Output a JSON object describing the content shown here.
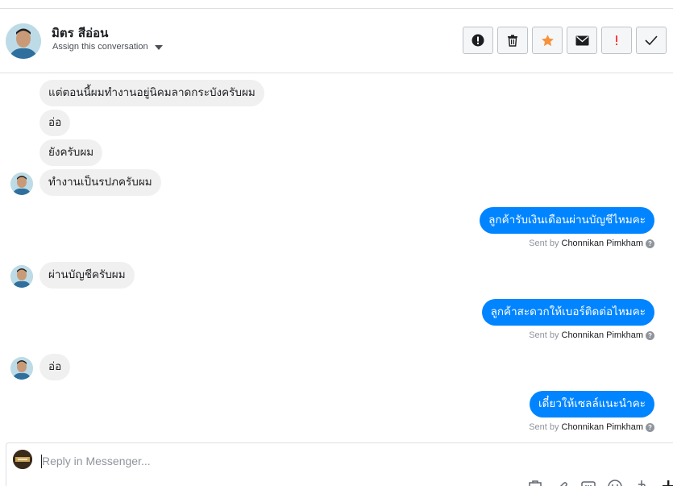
{
  "header": {
    "contact_name": "มิตร สีอ่อน",
    "assign_label": "Assign this conversation",
    "actions": [
      {
        "icon": "exclamation-circle-icon",
        "color": "#1c1e21"
      },
      {
        "icon": "trash-icon",
        "color": "#1c1e21"
      },
      {
        "icon": "star-icon",
        "color": "#f7923b"
      },
      {
        "icon": "envelope-icon",
        "color": "#1c1e21"
      },
      {
        "icon": "exclamation-icon",
        "color": "#fa3e3e"
      },
      {
        "icon": "checkmark-icon",
        "color": "#1c1e21"
      }
    ]
  },
  "messages": {
    "in_1": "แต่ตอนนี้ผมทำงานอยู่นิคมลาดกระบังครับผม",
    "in_2": "อ่อ",
    "in_3": "ยังครับผม",
    "in_4": "ทำงานเป็นรปภครับผม",
    "out_1": "ลูกค้ารับเงินเดือนผ่านบัญชีไหมคะ",
    "in_5": "ผ่านบัญชีครับผม",
    "out_2": "ลูกค้าสะดวกให้เบอร์ติดต่อไหมคะ",
    "in_6": "อ่อ",
    "out_3": "เดี๋ยวให้เซลล์แนะนำคะ"
  },
  "sent_by": {
    "prefix": "Sent by",
    "agent": "Chonnikan Pimkham"
  },
  "composer": {
    "placeholder": "Reply in Messenger..."
  },
  "colors": {
    "outgoing_bubble": "#0084ff",
    "incoming_bubble": "#f1f0f0",
    "star": "#f7923b",
    "alert": "#fa3e3e"
  }
}
